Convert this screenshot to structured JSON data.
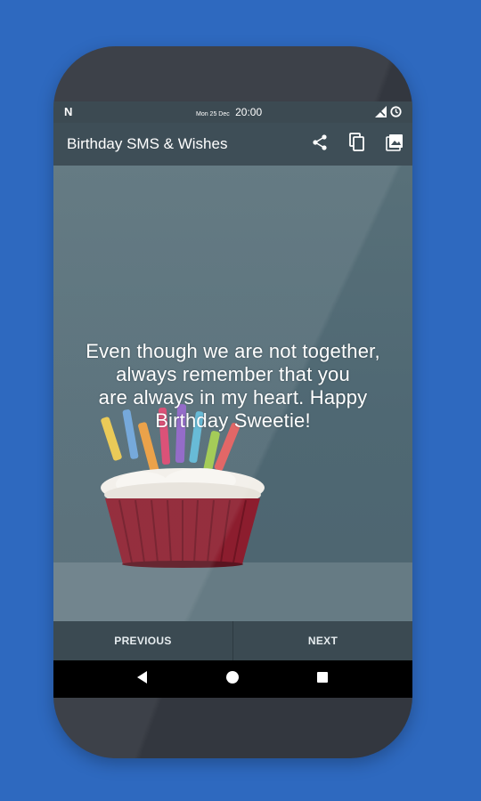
{
  "status_bar": {
    "notification_icon": "N",
    "date": "Mon 25 Dec",
    "time": "20:00",
    "icons": [
      "signal-off-icon",
      "alarm-icon"
    ]
  },
  "app_bar": {
    "title": "Birthday SMS & Wishes",
    "actions": [
      {
        "name": "share-icon",
        "label": "Share"
      },
      {
        "name": "copy-icon",
        "label": "Copy"
      },
      {
        "name": "image-icon",
        "label": "Image"
      }
    ]
  },
  "message": {
    "text": "Even though we are not together,\nalways remember that you\nare always in my heart. Happy\nBirthday Sweetie!"
  },
  "navigation": {
    "previous_label": "PREVIOUS",
    "next_label": "NEXT"
  },
  "system_nav": {
    "icons": [
      "back-icon",
      "home-icon",
      "recents-icon"
    ]
  },
  "colors": {
    "background": "#2e69bf",
    "phone_body": "#33373f",
    "app_bar": "#3e4e57",
    "content": "#587079",
    "cupcake_wrapper": "#8c1d2e",
    "frosting": "#f2efe9"
  }
}
